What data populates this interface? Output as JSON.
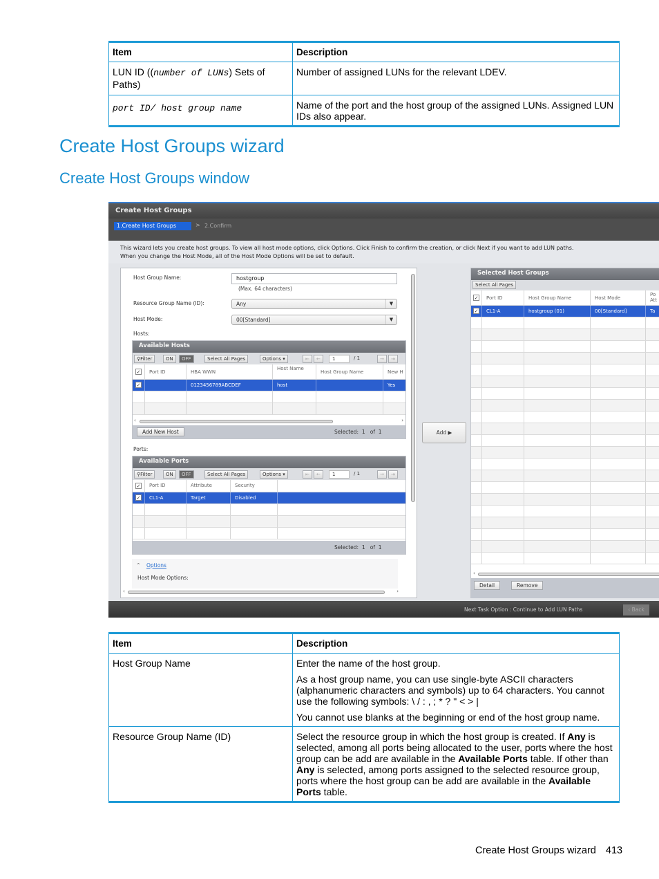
{
  "table1": {
    "headers": [
      "Item",
      "Description"
    ],
    "rows": [
      {
        "item_prefix": "LUN ID ((",
        "item_mono": "number of LUNs",
        "item_suffix": ") Sets of Paths)",
        "description": "Number of assigned LUNs for the relevant LDEV."
      },
      {
        "item_mono": "port ID/ host group name",
        "description": "Name of the port and the host group of the assigned LUNs. Assigned LUN IDs also appear."
      }
    ]
  },
  "heading1": "Create Host Groups wizard",
  "heading2": "Create Host Groups window",
  "window": {
    "title": "Create Host Groups",
    "steps": {
      "active": "1.Create Host Groups",
      "separator": ">",
      "next": "2.Confirm"
    },
    "intro_line1": "This wizard lets you create host groups. To view all host mode options, click Options. Click Finish to confirm the creation, or click Next if you want to add LUN paths.",
    "intro_line2": "When you change the Host Mode, all of the Host Mode Options will be set to default.",
    "form": {
      "host_group_name_label": "Host Group Name:",
      "host_group_name_value": "hostgroup",
      "host_group_name_hint": "(Max. 64 characters)",
      "resource_group_label": "Resource Group Name (ID):",
      "resource_group_value": "Any",
      "host_mode_label": "Host Mode:",
      "host_mode_value": "00[Standard]",
      "hosts_label": "Hosts:",
      "ports_label": "Ports:",
      "options_link": "Options",
      "host_mode_options_label": "Host Mode Options:"
    },
    "toolbar": {
      "filter": "Filter",
      "on": "ON",
      "off": "OFF",
      "select_all": "Select All Pages",
      "options": "Options ▾",
      "page": "1",
      "of_pages": "/ 1"
    },
    "available_hosts": {
      "title": "Available Hosts",
      "columns": [
        "Port ID",
        "HBA WWN",
        "Host Name",
        "Host Group Name",
        "New H"
      ],
      "rows": [
        {
          "port_id": "",
          "hba_wwn": "0123456789ABCDEF",
          "host_name": "host",
          "host_group_name": "",
          "new_host": "Yes"
        }
      ],
      "add_new_host": "Add New Host",
      "selected_label": "Selected:",
      "selected": "1",
      "of_label": "of",
      "total": "1"
    },
    "available_ports": {
      "title": "Available Ports",
      "columns": [
        "Port ID",
        "Attribute",
        "Security"
      ],
      "rows": [
        {
          "port_id": "CL1-A",
          "attribute": "Target",
          "security": "Disabled"
        }
      ],
      "selected_label": "Selected:",
      "selected": "1",
      "of_label": "of",
      "total": "1"
    },
    "add_button": "Add ▶",
    "selected_host_groups": {
      "title": "Selected Host Groups",
      "select_all": "Select All Pages",
      "columns": [
        "Port ID",
        "Host Group Name",
        "Host Mode",
        "Po Att"
      ],
      "rows": [
        {
          "port_id": "CL1-A",
          "host_group_name": "hostgroup (01)",
          "host_mode": "00[Standard]",
          "port_attr": "Ta"
        }
      ],
      "detail_button": "Detail",
      "remove_button": "Remove"
    },
    "next_task_option": "Next Task Option :  Continue to Add LUN Paths",
    "back_button": "‹ Back"
  },
  "table2": {
    "headers": [
      "Item",
      "Description"
    ],
    "rows": [
      {
        "item": "Host Group Name",
        "paragraphs": [
          "Enter the name of the host group.",
          "As a host group name, you can use single-byte ASCII characters (alphanumeric characters and symbols) up to 64 characters. You cannot use the following symbols: \\ / : , ; * ? \" < > |",
          "You cannot use blanks at the beginning or end of the host group name."
        ]
      },
      {
        "item": "Resource Group Name (ID)",
        "desc_parts": [
          {
            "text": "Select the resource group in which the host group is created. If ",
            "bold": false
          },
          {
            "text": "Any",
            "bold": true
          },
          {
            "text": " is selected, among all ports being allocated to the user, ports where the host group can be add are available in the ",
            "bold": false
          },
          {
            "text": "Available Ports",
            "bold": true
          },
          {
            "text": " table. If other than ",
            "bold": false
          },
          {
            "text": "Any",
            "bold": true
          },
          {
            "text": " is selected, among ports assigned to the selected resource group, ports where the host group can be add are available in the ",
            "bold": false
          },
          {
            "text": "Available Ports",
            "bold": true
          },
          {
            "text": " table.",
            "bold": false
          }
        ]
      }
    ]
  },
  "footer": {
    "title": "Create Host Groups wizard",
    "page": "413"
  }
}
